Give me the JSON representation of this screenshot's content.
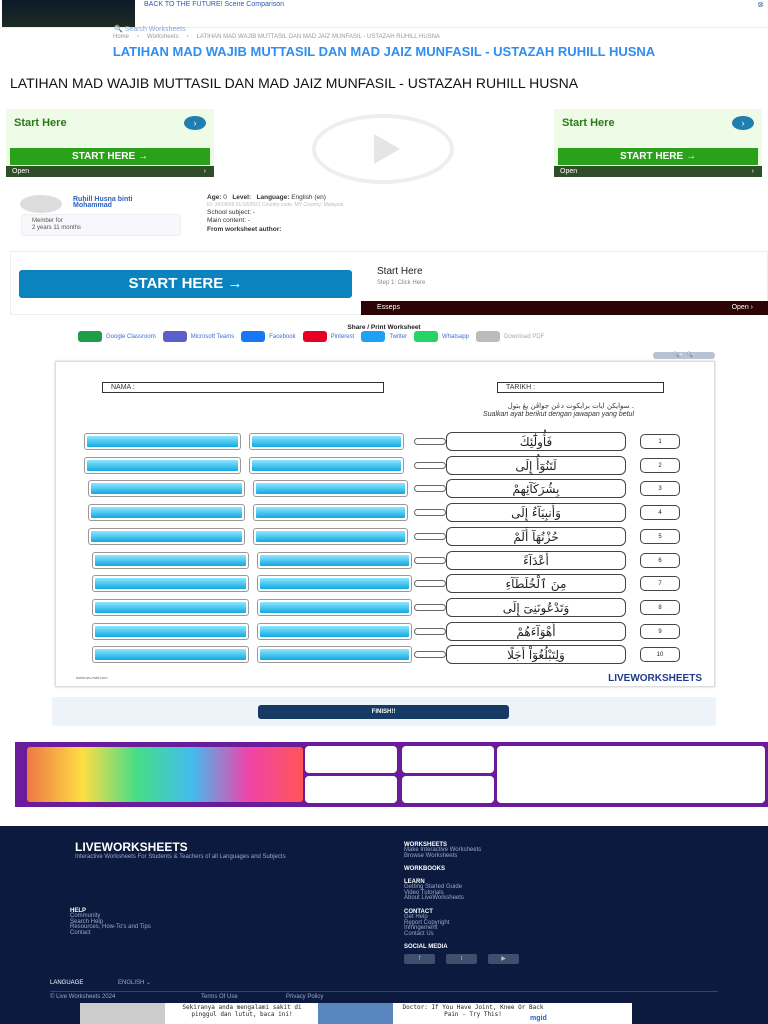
{
  "top_ad": {
    "title": "BACK TO THE FUTURE! Scene Comparison",
    "close": "⊗"
  },
  "search": {
    "label": "Search Worksheets"
  },
  "breadcrumb": [
    "Home",
    "›",
    "Worksheets",
    "›",
    "LATIHAN MAD WAJIB MUTTASIL DAN MAD JAIZ MUNFASIL - USTAZAH RUHILL HUSNA"
  ],
  "title": "LATIHAN MAD WAJIB MUTTASIL DAN MAD JAIZ MUNFASIL - USTAZAH RUHILL HUSNA",
  "side_ads": [
    {
      "heading": "Start Here",
      "button": "START HERE  →",
      "open": "Open",
      "arrow": "›"
    },
    {
      "heading": "Start Here",
      "button": "START HERE  →",
      "open": "Open",
      "arrow": "›"
    }
  ],
  "author": {
    "name": "Ruhill Husna binti Mohammad",
    "member_label": "Member for",
    "member_duration": "2 years 11 months"
  },
  "info": {
    "age_label": "Age:",
    "age": "0",
    "level_label": "Level:",
    "language_label": "Language:",
    "language": "English (en)",
    "meta": "ID: 3423659     01/10/2021     Country code: MY     Country: Malaysia",
    "school_subject": "School subject: -",
    "main_content": "Main content: -",
    "from_author": "From worksheet author:"
  },
  "banner_ad": {
    "button": "START HERE  →",
    "heading": "Start Here",
    "sub": "Step 1: Click Here",
    "brand": "Esseps",
    "open": "Open ›"
  },
  "share": {
    "title": "Share / Print Worksheet",
    "items": [
      "Google Classroom",
      "Microsoft Teams",
      "Facebook",
      "Pinterest",
      "Twitter",
      "Whatsapp",
      "Download PDF"
    ],
    "colors": [
      "#1e9e46",
      "#5b5fc7",
      "#1877f2",
      "#e60023",
      "#1da1f2",
      "#25d366",
      "#bbbbbb"
    ]
  },
  "zoom_controls": {
    "zoom_in": "🔍+",
    "zoom_out": "🔍-"
  },
  "worksheet": {
    "nama": "NAMA :",
    "tarikh": "TARIKH :",
    "instr_jawi": "سوايكن ايات برايكوت دڠن جواڤن يڠ بتول .",
    "instr_malay": "Sualkan ayat berikut dengan jawapan yang betul",
    "rows": [
      {
        "n": "1",
        "ar": "فَأُولَٰٓئِكَ"
      },
      {
        "n": "2",
        "ar": "لَتَنُوٓأُ إِلَى"
      },
      {
        "n": "3",
        "ar": "بِشُرَكَآئِهِمْ"
      },
      {
        "n": "4",
        "ar": "وَأَنبِيَآءُ إِلَى"
      },
      {
        "n": "5",
        "ar": "حُزْنُهَآ أَلَمْ"
      },
      {
        "n": "6",
        "ar": "أَعْدَآءً"
      },
      {
        "n": "7",
        "ar": "مِنَ ٱلْخُلَطَآءِ"
      },
      {
        "n": "8",
        "ar": "وَتَدْعُونَنِىٓ إِلَى"
      },
      {
        "n": "9",
        "ar": "أَهْوَآءَهُمْ"
      },
      {
        "n": "10",
        "ar": "وَلِتَبْلُغُوٓاْ أَجَلًا"
      }
    ],
    "logo": "LIVEWORKSHEETS"
  },
  "finish": "FINISH!!",
  "footer": {
    "logo": "LIVEWORKSHEETS",
    "tagline": "Interactive Worksheets For Students & Teachers of all Languages and Subjects",
    "help": {
      "title": "HELP",
      "links": [
        "Community",
        "Search Help",
        "Resources, How-To's and Tips",
        "Contact"
      ]
    },
    "worksheets": {
      "title": "WORKSHEETS",
      "links": [
        "Make Interactive Worksheets",
        "Browse Worksheets"
      ]
    },
    "workbooks": {
      "title": "WORKBOOKS"
    },
    "learn": {
      "title": "LEARN",
      "links": [
        "Getting Started Guide",
        "Video Tutorials",
        "About LiveWorksheets"
      ]
    },
    "contact": {
      "title": "CONTACT",
      "links": [
        "Get Help",
        "Report Copyright",
        "Infringement",
        "Contact Us"
      ]
    },
    "social": {
      "title": "SOCIAL MEDIA",
      "items": [
        "f",
        "t",
        "▶"
      ]
    },
    "language_label": "LANGUAGE",
    "language": "ENGLISH ⌄",
    "copyright": "© Live Worksheets 2024",
    "terms": "Terms Of Use",
    "privacy": "Privacy Policy"
  },
  "bottom_ad": {
    "text1": "Sekiranya anda mengalami sakit di pinggul dan lutut, baca ini!",
    "text2": "Doctor: If You Have Joint, Knee Or Back Pain - Try This!",
    "brand": "mgid"
  }
}
